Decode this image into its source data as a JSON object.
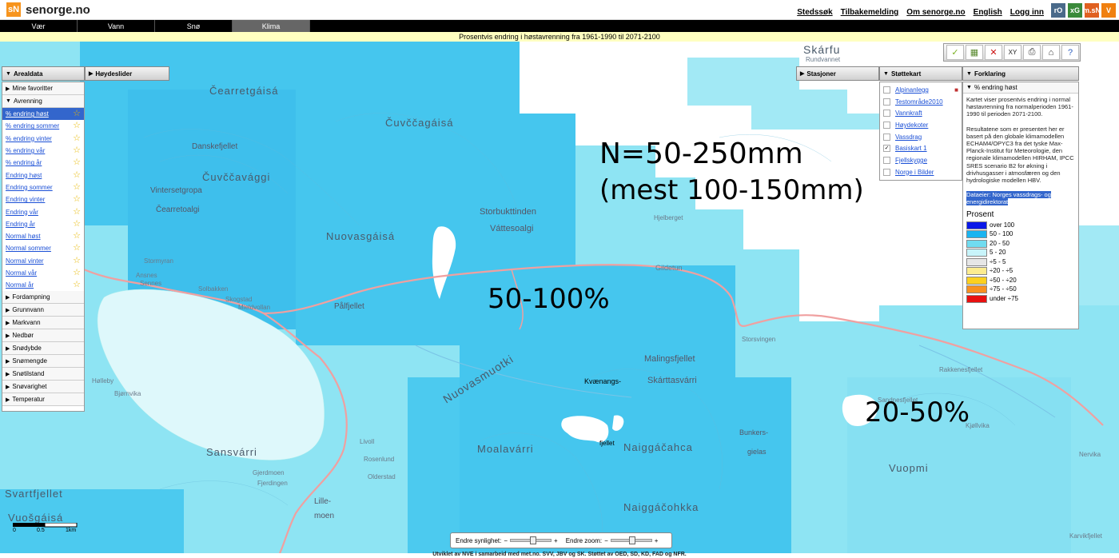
{
  "header": {
    "logo_badge": "sN",
    "logo_text": "senorge.no",
    "links": [
      "Stedssøk",
      "Tilbakemelding",
      "Om senorge.no",
      "English",
      "Logg inn"
    ],
    "partners": [
      {
        "label": "rO",
        "color": "#4a6a8a"
      },
      {
        "label": "xG",
        "color": "#3a8a3a"
      },
      {
        "label": "m.sN",
        "color": "#e06020"
      },
      {
        "label": "V",
        "color": "#f08010"
      }
    ]
  },
  "nav": {
    "tabs": [
      "Vær",
      "Vann",
      "Snø",
      "Klima"
    ],
    "active": "Klima"
  },
  "subtitle": "Prosentvis endring i høstavrenning fra 1961-1990 til 2071-2100",
  "left_panel": {
    "tab1": "Arealdata",
    "tab2": "Høydeslider",
    "favorites": "Mine favoritter",
    "open_section": "Avrenning",
    "items": [
      "% endring høst",
      "% endring sommer",
      "% endring vinter",
      "% endring vår",
      "% endring år",
      "Endring høst",
      "Endring sommer",
      "Endring vinter",
      "Endring vår",
      "Endring år",
      "Normal høst",
      "Normal sommer",
      "Normal vinter",
      "Normal vår",
      "Normal år"
    ],
    "selected_index": 0,
    "sections": [
      "Fordampning",
      "Grunnvann",
      "Markvann",
      "Nedbør",
      "Snødybde",
      "Snømengde",
      "Snøtilstand",
      "Snøvarighet",
      "Temperatur"
    ]
  },
  "right_tabs": {
    "stasjoner": "Stasjoner",
    "stottekart": "Støttekart",
    "forklaring": "Forklaring"
  },
  "stottekart": [
    {
      "label": "Alpinanlegg",
      "checked": false
    },
    {
      "label": "Testområde2010",
      "checked": false
    },
    {
      "label": "Vannkraft",
      "checked": false
    },
    {
      "label": "Høydekoter",
      "checked": false
    },
    {
      "label": "Vassdrag",
      "checked": false
    },
    {
      "label": "Basiskart 1",
      "checked": true
    },
    {
      "label": "Fjellskygge",
      "checked": false
    },
    {
      "label": "Norge i Bilder",
      "checked": false
    }
  ],
  "forklaring": {
    "sub": "% endring høst",
    "p1": "Kartet viser prosentvis endring i normal høstavrenning fra normalperioden 1961-1990 til perioden 2071-2100.",
    "p2": "Resultatene som er presentert her er basert på den globale klimamodellen ECHAM4/OPYC3 fra det tyske Max-Planck-Institut für Meteorologie, den regionale klimamodellen HIRHAM, IPCC SRES scenario B2 for økning i drivhusgasser i atmosfæren og den hydrologiske modellen HBV.",
    "source": "Dataeier: Norges vassdrags- og energidirektorat",
    "legend_title": "Prosent",
    "legend": [
      {
        "label": "over 100",
        "color": "#0a18e8"
      },
      {
        "label": "50 - 100",
        "color": "#1ab4f0"
      },
      {
        "label": "20 - 50",
        "color": "#70dcf0"
      },
      {
        "label": "5 - 20",
        "color": "#c8f4fa"
      },
      {
        "label": "÷5 - 5",
        "color": "#e6e6e6"
      },
      {
        "label": "÷20 - ÷5",
        "color": "#fcec90"
      },
      {
        "label": "÷50 - ÷20",
        "color": "#fcd020"
      },
      {
        "label": "÷75 - ÷50",
        "color": "#f89020"
      },
      {
        "label": "under ÷75",
        "color": "#e81010"
      }
    ]
  },
  "toolbar": [
    "check-icon",
    "grid-icon",
    "close-icon",
    "xy-icon",
    "print-icon",
    "home-icon",
    "help-icon"
  ],
  "toolbar_glyphs": [
    "✓",
    "▦",
    "✕",
    "XY",
    "⎙",
    "⌂",
    "?"
  ],
  "sliders": {
    "visibility": "Endre synlighet:",
    "zoom": "Endre zoom:"
  },
  "scale": {
    "ticks": [
      "0",
      "0.5",
      "1km"
    ]
  },
  "overlay": {
    "n_line1": "N=50-250mm",
    "n_line2": "(mest 100-150mm)",
    "label_center": "50-100%",
    "label_right": "20-50%"
  },
  "map_labels": {
    "big": [
      "Skárfu",
      "Čearretgáisá",
      "Čuvččagáisá",
      "Danskefjellet",
      "Čuvččavággi",
      "Vintersetgropa",
      "Čearretoalgi",
      "Storbukttinden",
      "Váttesoalgi",
      "Nuovasgáisá",
      "Pålfjellet",
      "Malingsfjellet",
      "Skárttasvárri",
      "Kvænangs-",
      "fjellet",
      "Naiggáčahca",
      "Bunkers-",
      "gielas",
      "Moalavárri",
      "Sansvárri",
      "Svartfjellet",
      "Vuošgáisá",
      "Naiggáčohkka",
      "Vuopmi",
      "Lille-",
      "moen",
      "Nuovasmuotki"
    ],
    "small": [
      "Rundvannet",
      "Gildetun",
      "Rakkenesfjellet",
      "Storsvingen",
      "Sandnesfjellet",
      "Karvikfjellet",
      "Skogstad",
      "Mieldvollan",
      "Livoll",
      "Rosenlund",
      "Olderstad",
      "Hjelberget",
      "Stormyran",
      "Ansnes",
      "Sennes",
      "Gjerdmoen",
      "Fjerdingen",
      "Nervika",
      "Kjøllvika",
      "Hølleby",
      "Solbakken",
      "Bjørnvika"
    ]
  },
  "footer": "Utviklet av NVE i samarbeid med met.no. SVV, JBV og SK. Støttet av OED, SD, KD, FAD og NFR."
}
